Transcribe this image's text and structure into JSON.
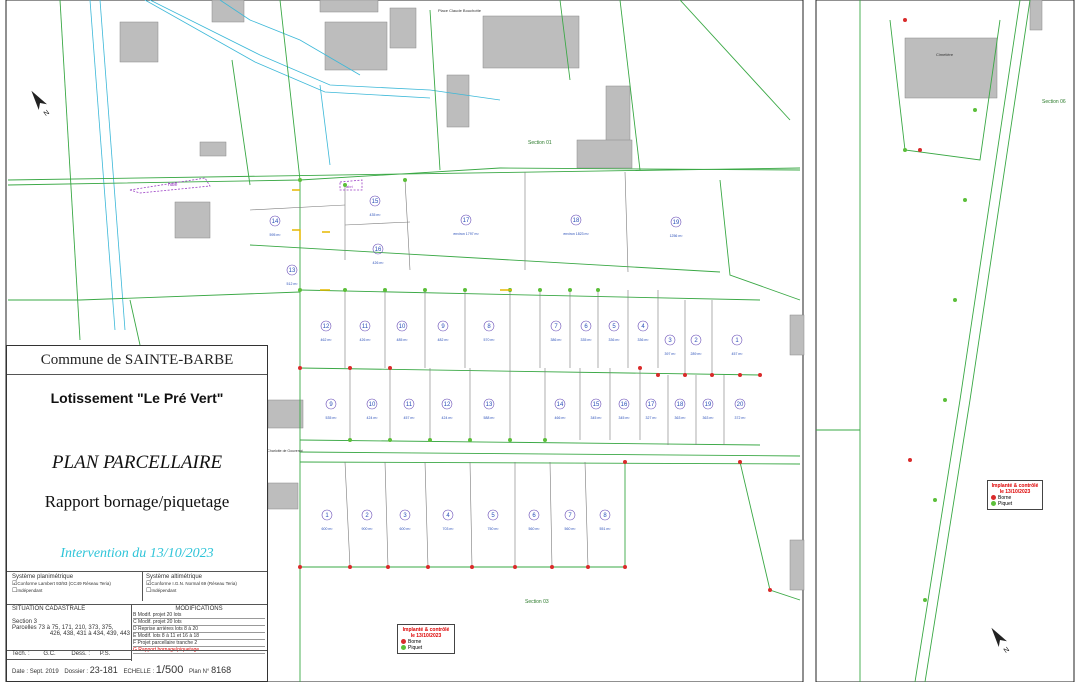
{
  "title_block": {
    "commune": "Commune de SAINTE-BARBE",
    "lotissement": "Lotissement \"Le Pré Vert\"",
    "plan_title": "PLAN PARCELLAIRE",
    "report_title": "Rapport bornage/piquetage",
    "intervention": "Intervention du 13/10/2023",
    "syst_plani_label": "Système planimétrique",
    "syst_plani_opt1": "Conforme Lambert 93/93 (CC49 Réseau Teria)",
    "syst_plani_opt2": "Indépendant",
    "syst_alti_label": "Système altimétrique",
    "syst_alti_opt1": "Conforme I.G.N. Normal 69 (Réseau Teria)",
    "syst_alti_opt2": "Indépendant",
    "situation_label": "SITUATION CADASTRALE",
    "section": "Section 3",
    "parcelles": "Parcelles 73 à 75, 171, 210, 373, 375,",
    "parcelles2": "426, 438, 431 à 434, 439, 443",
    "modifications_label": "MODIFICATIONS",
    "modif_rows": [
      {
        "letter": "B",
        "text": "Modif. projet 20 lots"
      },
      {
        "letter": "C",
        "text": "Modif. projet 20 lots"
      },
      {
        "letter": "D",
        "text": "Reprise arrières lots 8 à 20"
      },
      {
        "letter": "E",
        "text": "Modif. lots 8 à 11 et 16 à 18"
      },
      {
        "letter": "F",
        "text": "Projet parcellaire tranche 2"
      },
      {
        "letter": "G",
        "text": "Rapport bornage/piquetage"
      }
    ],
    "tech_label": "Tech. :",
    "tech_value": "G.C.",
    "dess_label": "Dess. :",
    "dess_value": "P.S.",
    "date_label": "Date :",
    "date_value": "Sept. 2019",
    "dossier_label": "Dossier :",
    "dossier_value": "23-181",
    "echelle_label": "ECHELLE :",
    "echelle_value": "1/500",
    "plan_no_label": "Plan N°",
    "plan_no_value": "8168"
  },
  "map_labels": {
    "place": "Place Claude Bouchotte",
    "section01": "Section 01",
    "section03": "Section 03",
    "section06": "Section 06",
    "cimetiere": "Cimetière",
    "rue": "Rue Charlotte de Gouvenot",
    "haie": "haie",
    "abri": "abri"
  },
  "legend": {
    "title": "Implanté & contrôlé le 13/10/2023",
    "borne": "Borne",
    "piquet": "Piquet",
    "borne_color": "#d92b2b",
    "piquet_color": "#5cbf3a"
  },
  "lots_top": [
    {
      "n": "14",
      "area": "595 m²"
    },
    {
      "n": "15",
      "area": "435 m²"
    },
    {
      "n": "16",
      "area": "426 m²"
    },
    {
      "n": "13",
      "area": "512 m²"
    },
    {
      "n": "17",
      "area": "environ 1797 m²"
    },
    {
      "n": "18",
      "area": "environ 1823 m²"
    },
    {
      "n": "19",
      "area": "1256 m²"
    }
  ],
  "lots_row1": [
    {
      "n": "12",
      "area": "462 m²"
    },
    {
      "n": "11",
      "area": "426 m²"
    },
    {
      "n": "10",
      "area": "485 m²"
    },
    {
      "n": "9",
      "area": "482 m²"
    },
    {
      "n": "8",
      "area": "570 m²"
    },
    {
      "n": "7",
      "area": "386 m²"
    },
    {
      "n": "6",
      "area": "335 m²"
    },
    {
      "n": "5",
      "area": "336 m²"
    },
    {
      "n": "4",
      "area": "336 m²"
    },
    {
      "n": "3",
      "area": "397 m²"
    },
    {
      "n": "2",
      "area": "289 m²"
    },
    {
      "n": "1",
      "area": "457 m²"
    }
  ],
  "lots_row2": [
    {
      "n": "9",
      "area": "535 m²"
    },
    {
      "n": "10",
      "area": "424 m²"
    },
    {
      "n": "11",
      "area": "457 m²"
    },
    {
      "n": "12",
      "area": "424 m²"
    },
    {
      "n": "13",
      "area": "588 m²"
    },
    {
      "n": "14",
      "area": "466 m²"
    },
    {
      "n": "15",
      "area": "345 m²"
    },
    {
      "n": "16",
      "area": "345 m²"
    },
    {
      "n": "17",
      "area": "327 m²"
    },
    {
      "n": "18",
      "area": "363 m²"
    },
    {
      "n": "19",
      "area": "363 m²"
    },
    {
      "n": "20",
      "area": "372 m²"
    }
  ],
  "lots_row3": [
    {
      "n": "1",
      "area": "600 m²"
    },
    {
      "n": "2",
      "area": "900 m²"
    },
    {
      "n": "3",
      "area": "600 m²"
    },
    {
      "n": "4",
      "area": "703 m²"
    },
    {
      "n": "5",
      "area": "750 m²"
    },
    {
      "n": "6",
      "area": "560 m²"
    },
    {
      "n": "7",
      "area": "560 m²"
    },
    {
      "n": "8",
      "area": "551 m²"
    }
  ]
}
